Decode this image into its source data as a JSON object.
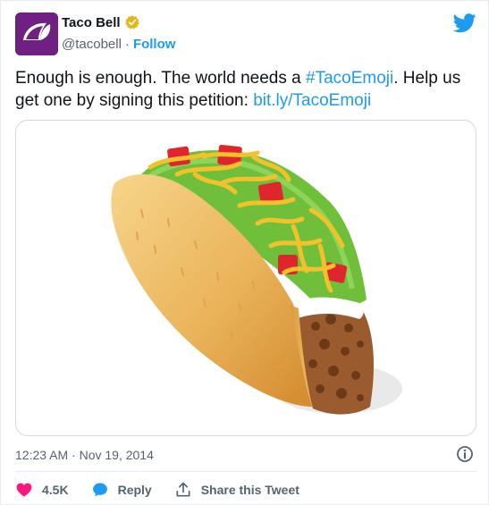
{
  "tweet": {
    "display_name": "Taco Bell",
    "handle": "@tacobell",
    "separator": "·",
    "follow_label": "Follow",
    "text_part1": "Enough is enough. The world needs a ",
    "hashtag": "#TacoEmoji",
    "text_part2": ". Help us get one by signing this petition: ",
    "link": "bit.ly/TacoEmoji",
    "timestamp": "12:23 AM · Nov 19, 2014",
    "media_description": "taco emoji illustration"
  },
  "actions": {
    "like_count": "4.5K",
    "reply_label": "Reply",
    "share_label": "Share this Tweet"
  },
  "colors": {
    "brand_purple": "#702082",
    "link_blue": "#1d9bf0",
    "like_red": "#f91880",
    "verified_gold": "#e2b719"
  },
  "icons": [
    "taco-bell-logo-icon",
    "verified-badge-icon",
    "twitter-bird-icon",
    "info-icon",
    "heart-icon",
    "reply-bubble-icon",
    "share-icon"
  ]
}
